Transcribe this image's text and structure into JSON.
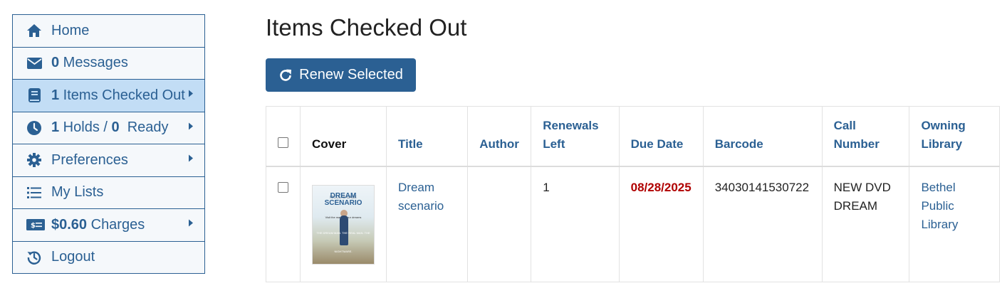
{
  "sidebar": {
    "home": "Home",
    "messages_count": "0",
    "messages_label": " Messages",
    "checked_count": "1",
    "checked_label": " Items Checked Out",
    "holds_count": "1",
    "holds_mid": " Holds / ",
    "holds_ready_count": "0",
    "holds_ready_label": "  Ready",
    "preferences": "Preferences",
    "my_lists": "My Lists",
    "charges_amount": "$0.60",
    "charges_label": " Charges",
    "logout": "Logout"
  },
  "main": {
    "title": "Items Checked Out",
    "renew_button": "Renew Selected"
  },
  "table": {
    "headers": {
      "cover": "Cover",
      "title": "Title",
      "author": "Author",
      "renewals_left": "Renewals Left",
      "due_date": "Due Date",
      "barcode": "Barcode",
      "call_number": "Call Number",
      "owning_library": "Owning Library"
    },
    "rows": [
      {
        "title": "Dream scenario",
        "author": "",
        "renewals_left": "1",
        "due_date": "08/28/2025",
        "barcode": "34030141530722",
        "call_number": "NEW DVD DREAM",
        "owning_library": "Bethel Public Library",
        "cover": {
          "top_text": "NICOLAS CAGE",
          "title_text": "DREAM SCENARIO",
          "tagline": "Visit the man of your dreams",
          "bottom_text": "THE DREAM MAN. THE REAL MAN. THE NIGHTMARE."
        }
      }
    ]
  },
  "colors": {
    "brand": "#2b6093",
    "active_nav": "#c2ddf5",
    "due_date": "#b00000"
  },
  "icons": {
    "home": "home-icon",
    "messages": "envelope-icon",
    "checked_out": "book-icon",
    "holds": "clock-icon",
    "preferences": "gear-icon",
    "lists": "list-icon",
    "charges": "money-icon",
    "logout": "history-icon",
    "renew": "refresh-icon"
  }
}
